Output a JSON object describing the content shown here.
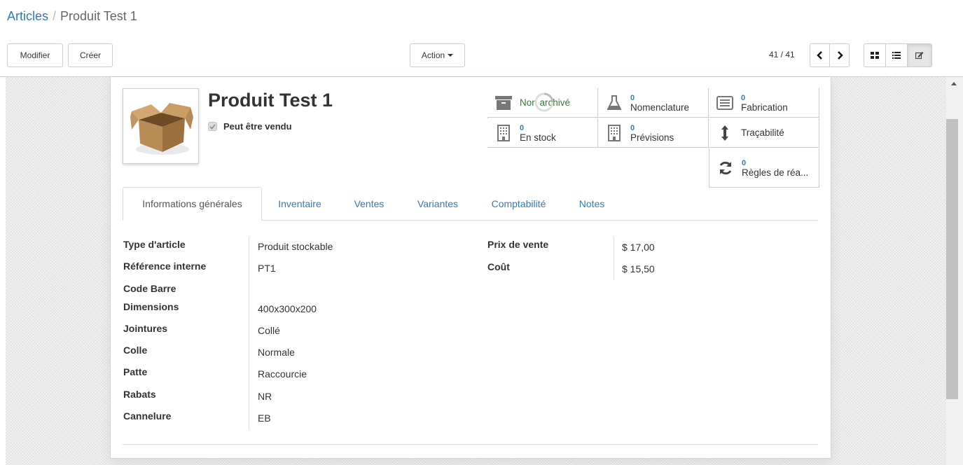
{
  "breadcrumb": {
    "parent": "Articles",
    "separator": "/",
    "current": "Produit Test 1"
  },
  "buttons": {
    "edit": "Modifier",
    "create": "Créer",
    "action": "Action"
  },
  "pager": {
    "value": "41 / 41"
  },
  "product": {
    "name": "Produit Test 1",
    "sale_ok_label": "Peut être vendu",
    "sale_ok": true
  },
  "smart_buttons": [
    {
      "number": "",
      "label": "Non archivé",
      "icon": "archive-icon"
    },
    {
      "number": "0",
      "label": "Nomenclature",
      "icon": "flask-icon"
    },
    {
      "number": "0",
      "label": "Fabrication",
      "icon": "list-alt-icon"
    },
    {
      "number": "0",
      "label": "En stock",
      "icon": "building-icon"
    },
    {
      "number": "0",
      "label": "Prévisions",
      "icon": "building-icon"
    },
    {
      "number": "",
      "label": "Traçabilité",
      "icon": "arrows-v-icon"
    },
    {
      "number": "0",
      "label": "Règles de réa...",
      "icon": "refresh-icon"
    }
  ],
  "tabs": [
    "Informations générales",
    "Inventaire",
    "Ventes",
    "Variantes",
    "Comptabilité",
    "Notes"
  ],
  "fields_left": [
    {
      "label": "Type d'article",
      "value": "Produit stockable"
    },
    {
      "label": "Référence interne",
      "value": "PT1"
    },
    {
      "label": "Code Barre",
      "value": ""
    },
    {
      "label": "Dimensions",
      "value": "400x300x200"
    },
    {
      "label": "Jointures",
      "value": "Collé"
    },
    {
      "label": "Colle",
      "value": "Normale"
    },
    {
      "label": "Patte",
      "value": "Raccourcie"
    },
    {
      "label": "Rabats",
      "value": "NR"
    },
    {
      "label": "Cannelure",
      "value": "EB"
    }
  ],
  "fields_right": [
    {
      "label": "Prix de vente",
      "value": "$ 17,00"
    },
    {
      "label": "Coût",
      "value": "$ 15,50"
    }
  ],
  "colors": {
    "link": "#337ab7",
    "archive_text": "#3c763d"
  }
}
